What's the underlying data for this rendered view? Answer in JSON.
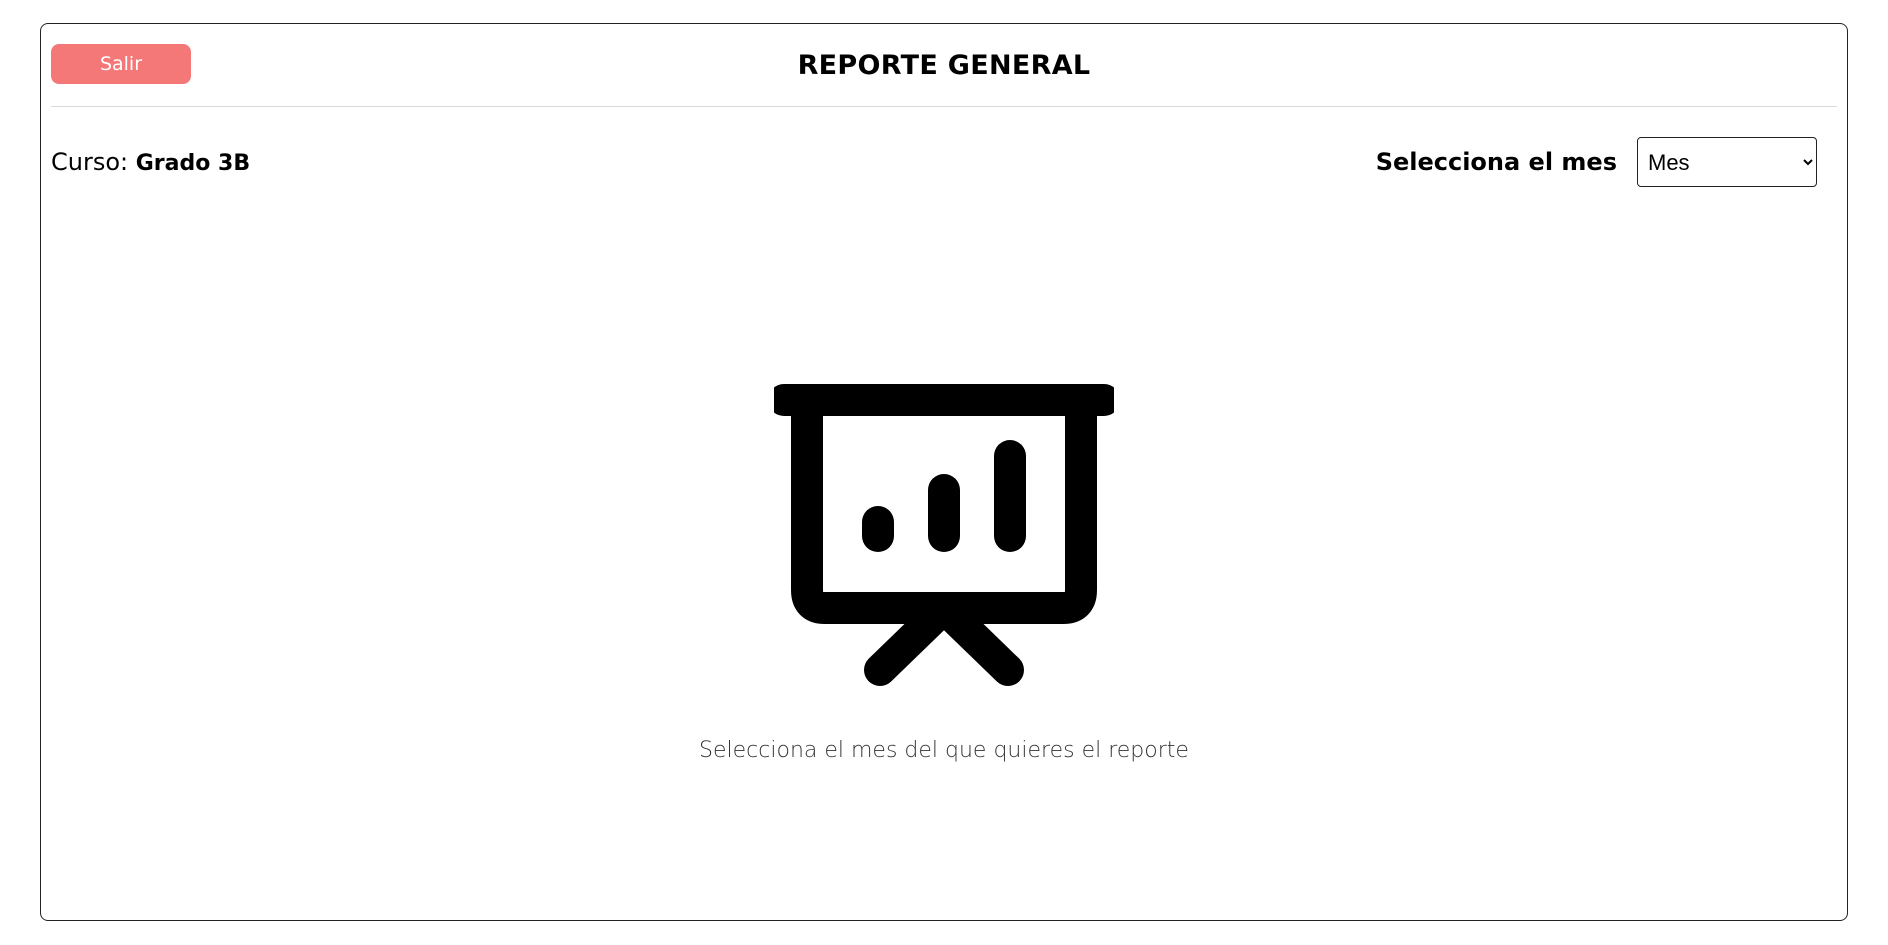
{
  "header": {
    "exit_label": "Salir",
    "title": "REPORTE GENERAL"
  },
  "course": {
    "label": "Curso:",
    "value": "Grado 3B"
  },
  "month_selector": {
    "label": "Selecciona el mes",
    "selected": "Mes"
  },
  "empty_state": {
    "icon": "presentation-chart-icon",
    "message": "Selecciona el mes del que quieres el reporte"
  },
  "colors": {
    "exit_button": "#f57878",
    "border": "#222222",
    "divider": "#d9d9d9"
  }
}
